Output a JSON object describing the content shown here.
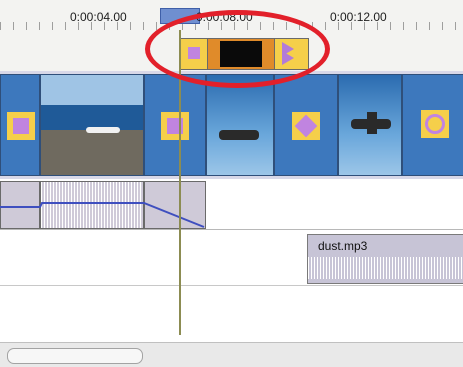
{
  "ruler": {
    "labels": [
      "0:00:04.00",
      "0:00:08.00",
      "0:00:12.00"
    ]
  },
  "music_clip": {
    "name": "dust.mp3"
  },
  "colors": {
    "highlight": "#e2202a",
    "transition_yellow": "#f5cf4a",
    "transition_orange": "#e08b2a",
    "transition_purple": "#c084e0",
    "timeline_bg": "#f3f3f1"
  },
  "icons": [
    "playhead-marker",
    "transition-icon",
    "waveform"
  ]
}
